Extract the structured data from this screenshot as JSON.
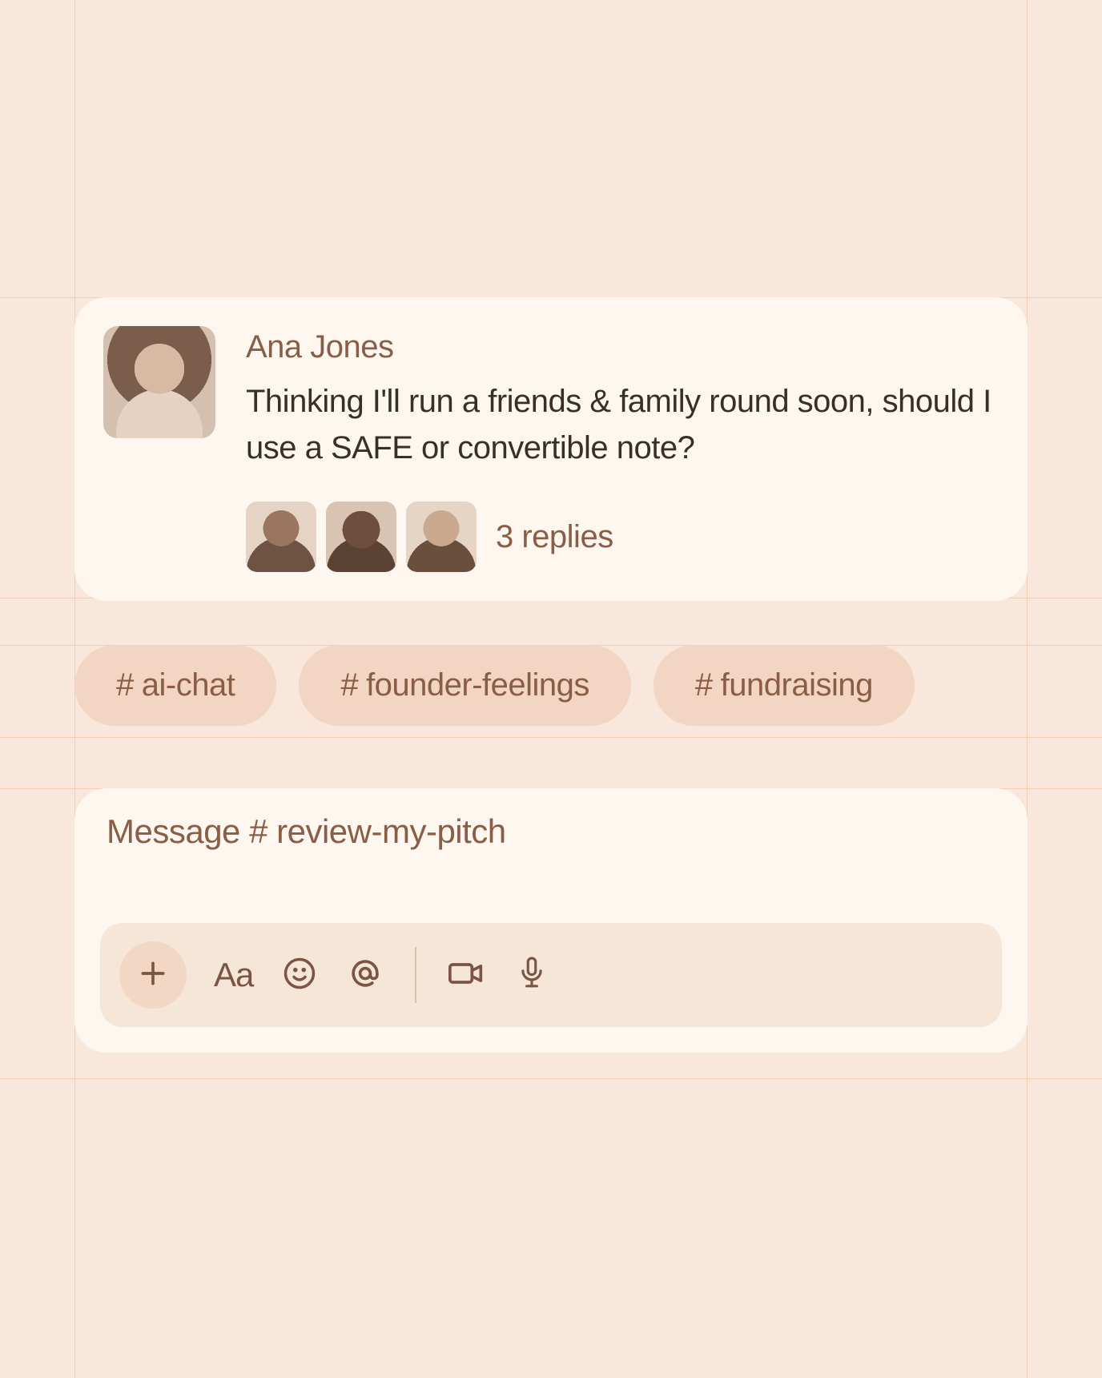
{
  "message": {
    "author": "Ana Jones",
    "text": "Thinking I'll run a friends & family round soon, should I use a SAFE or convertible note?",
    "replies_label": "3 replies",
    "reply_avatar_count": 3
  },
  "channels": [
    {
      "name": "ai-chat"
    },
    {
      "name": "founder-feelings"
    },
    {
      "name": "fundraising"
    }
  ],
  "compose": {
    "placeholder": "Message  # review-my-pitch"
  },
  "icons": {
    "plus": "plus-icon",
    "format": "Aa",
    "emoji": "emoji-icon",
    "mention": "mention-icon",
    "video": "video-icon",
    "mic": "mic-icon"
  },
  "colors": {
    "background": "#fae7db",
    "card": "#fdf7f0",
    "chip": "#f2d5c3",
    "toolbar": "#f6e6d8",
    "accent_text": "#8a5d47",
    "body_text": "#3a2f28",
    "grid": "#f3cdb4"
  }
}
